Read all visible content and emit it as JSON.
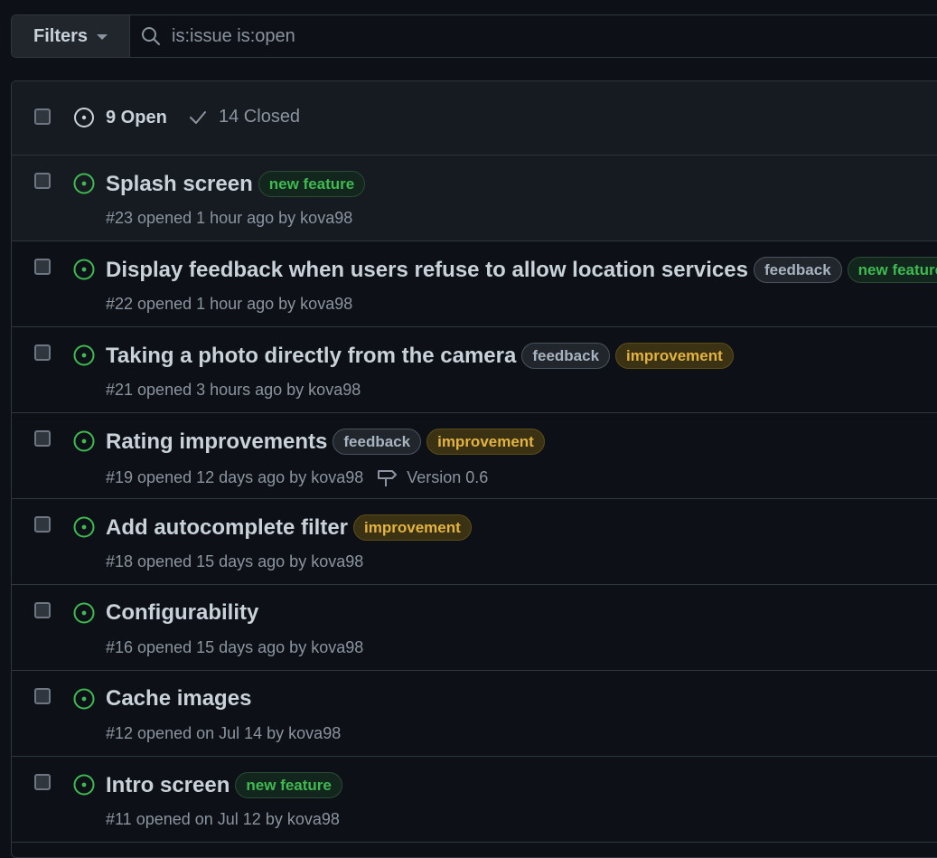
{
  "filters": {
    "label": "Filters"
  },
  "search": {
    "value": "is:issue is:open"
  },
  "header": {
    "open_label": "9 Open",
    "closed_label": "14 Closed"
  },
  "issues": [
    {
      "title": "Splash screen",
      "labels": [
        {
          "name": "new feature",
          "kind": "newfeature"
        }
      ],
      "meta": "#23 opened 1 hour ago by kova98",
      "milestone": ""
    },
    {
      "title": "Display feedback when users refuse to allow location services",
      "labels": [
        {
          "name": "feedback",
          "kind": "feedback"
        },
        {
          "name": "new feature",
          "kind": "newfeature"
        }
      ],
      "meta": "#22 opened 1 hour ago by kova98",
      "milestone": ""
    },
    {
      "title": "Taking a photo directly from the camera",
      "labels": [
        {
          "name": "feedback",
          "kind": "feedback"
        },
        {
          "name": "improvement",
          "kind": "improvement"
        }
      ],
      "meta": "#21 opened 3 hours ago by kova98",
      "milestone": ""
    },
    {
      "title": "Rating improvements",
      "labels": [
        {
          "name": "feedback",
          "kind": "feedback"
        },
        {
          "name": "improvement",
          "kind": "improvement"
        }
      ],
      "meta": "#19 opened 12 days ago by kova98",
      "milestone": "Version 0.6"
    },
    {
      "title": "Add autocomplete filter",
      "labels": [
        {
          "name": "improvement",
          "kind": "improvement"
        }
      ],
      "meta": "#18 opened 15 days ago by kova98",
      "milestone": ""
    },
    {
      "title": "Configurability",
      "labels": [],
      "meta": "#16 opened 15 days ago by kova98",
      "milestone": ""
    },
    {
      "title": "Cache images",
      "labels": [],
      "meta": "#12 opened on Jul 14 by kova98",
      "milestone": ""
    },
    {
      "title": "Intro screen",
      "labels": [
        {
          "name": "new feature",
          "kind": "newfeature"
        }
      ],
      "meta": "#11 opened on Jul 12 by kova98",
      "milestone": ""
    }
  ],
  "icons": {
    "open_issue": "issue-opened-icon",
    "closed": "check-icon",
    "search": "search-icon",
    "milestone": "milestone-icon"
  },
  "colors": {
    "open_green": "#3fb950",
    "feedback": "#a8b3c0",
    "improvement": "#e3b341"
  }
}
